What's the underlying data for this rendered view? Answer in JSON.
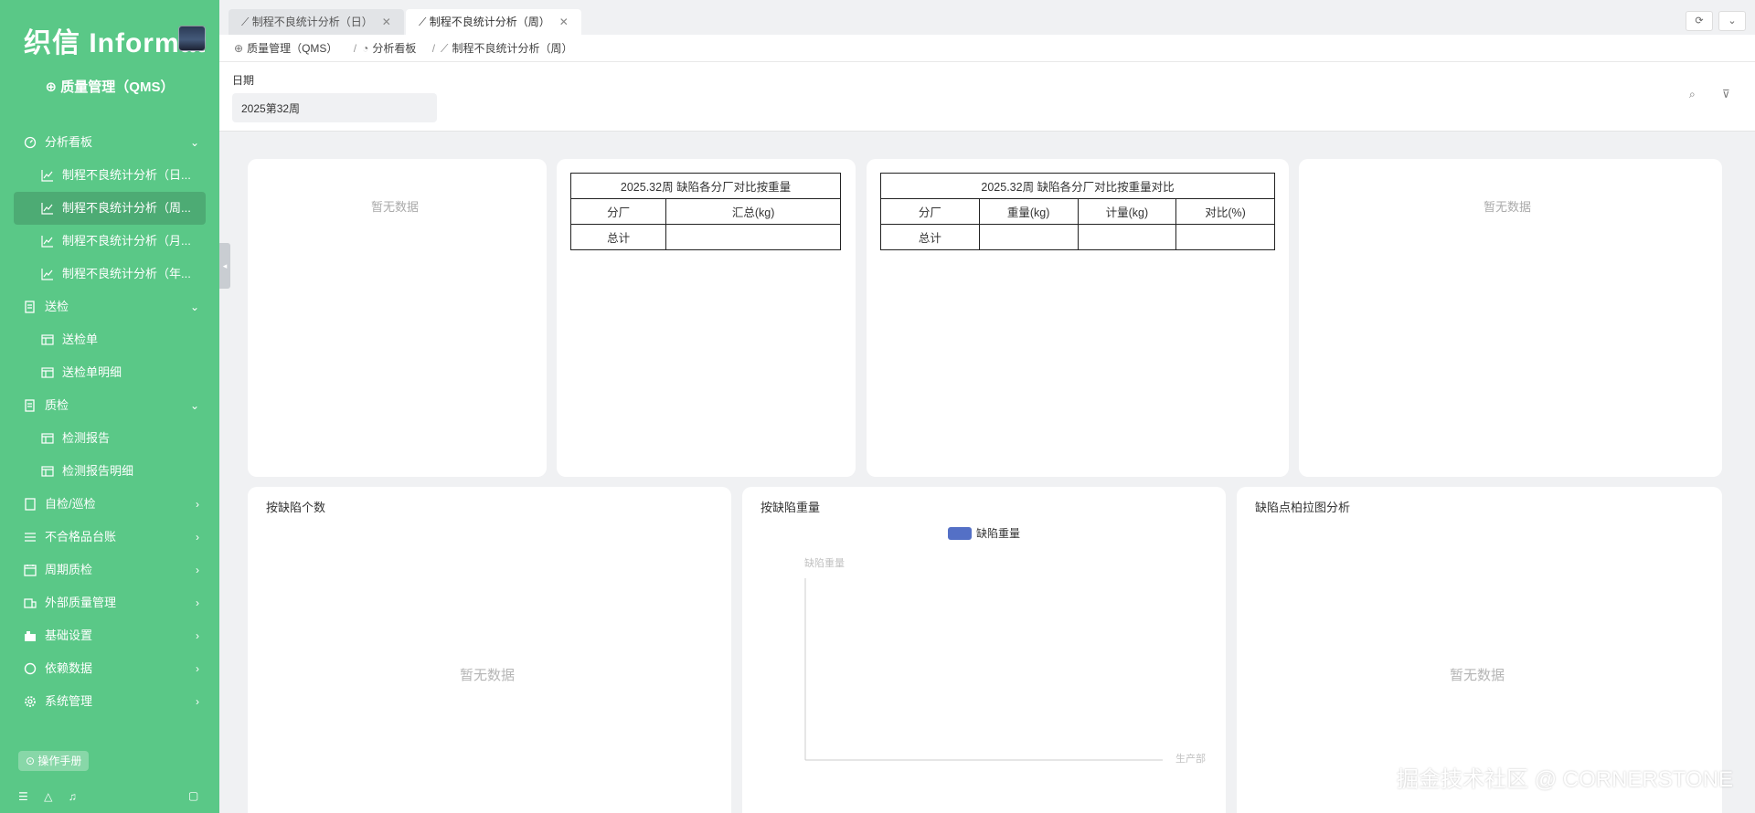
{
  "sidebar": {
    "logo": "织信 Informat",
    "app_title": "质量管理（QMS）",
    "groups": [
      {
        "label": "分析看板",
        "children": [
          "制程不良统计分析（日...",
          "制程不良统计分析（周...",
          "制程不良统计分析（月...",
          "制程不良统计分析（年..."
        ]
      },
      {
        "label": "送检",
        "children": [
          "送检单",
          "送检单明细"
        ]
      },
      {
        "label": "质检",
        "children": [
          "检测报告",
          "检测报告明细"
        ]
      }
    ],
    "collapsed": [
      "自检/巡检",
      "不合格品台账",
      "周期质检",
      "外部质量管理",
      "基础设置",
      "依赖数据",
      "系统管理"
    ],
    "manual": "操作手册"
  },
  "tabs": [
    {
      "label": "制程不良统计分析（日）"
    },
    {
      "label": "制程不良统计分析（周）"
    }
  ],
  "breadcrumb": [
    "质量管理（QMS）",
    "分析看板",
    "制程不良统计分析（周）"
  ],
  "filter": {
    "label": "日期",
    "value": "2025第32周"
  },
  "no_data": "暂无数据",
  "table1": {
    "title": "2025.32周 缺陷各分厂对比按重量",
    "headers": [
      "分厂",
      "汇总(kg)"
    ],
    "row_label": "总计"
  },
  "table2": {
    "title": "2025.32周 缺陷各分厂对比按重量对比",
    "headers": [
      "分厂",
      "重量(kg)",
      "计量(kg)",
      "对比(%)"
    ],
    "row_label": "总计"
  },
  "charts": {
    "count_title": "按缺陷个数",
    "weight_title": "按缺陷重量",
    "pareto_title": "缺陷点柏拉图分析"
  },
  "chart_data": {
    "type": "bar",
    "legend": "缺陷重量",
    "ylabel": "缺陷重量",
    "categories": [
      "生产部"
    ],
    "values": [],
    "color": "#5470c6"
  },
  "watermark": "掘金技术社区 @ CORNERSTONE",
  "colors": {
    "sidebar": "#5ac887",
    "bar": "#5470c6"
  }
}
